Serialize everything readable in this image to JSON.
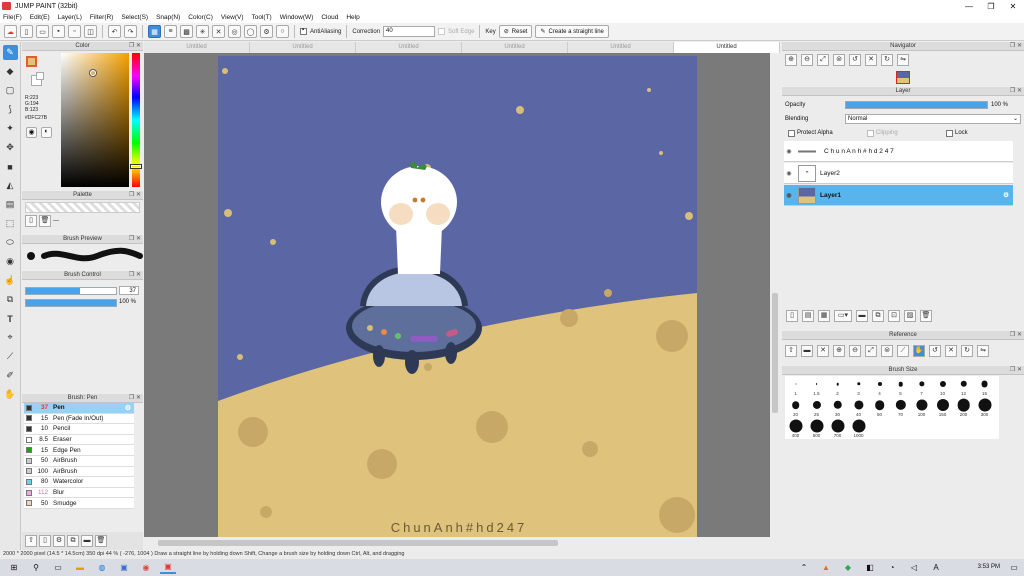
{
  "window": {
    "title": "JUMP PAINT (32bit)",
    "min": "—",
    "max": "❐",
    "close": "✕"
  },
  "menu": [
    "File(F)",
    "Edit(E)",
    "Layer(L)",
    "Filter(R)",
    "Select(S)",
    "Snap(N)",
    "Color(C)",
    "View(V)",
    "Tool(T)",
    "Window(W)",
    "Cloud",
    "Help"
  ],
  "toolbar": {
    "antialiasing_label": "AntiAliasing",
    "correction_label": "Correction",
    "correction_value": "40",
    "soft_edge_label": "Soft Edge",
    "key_label": "Key",
    "reset_label": "Reset",
    "straight_line_label": "Create a straight line"
  },
  "tabs": [
    "Untitled",
    "Untitled",
    "Untitled",
    "Untitled",
    "Untitled",
    "Untitled"
  ],
  "color_panel": {
    "title": "Color",
    "r": "R:223",
    "g": "G:194",
    "b": "B:123",
    "hex": "#DFC27B",
    "fg_color": "#dfc27b"
  },
  "palette": {
    "title": "Palette",
    "ellipsis": "---"
  },
  "brush_preview": {
    "title": "Brush Preview"
  },
  "brush_control": {
    "title": "Brush Control",
    "size": "37",
    "size_level": 0.6,
    "opacity": "100 %",
    "opacity_level": 1.0
  },
  "brush_list": {
    "title": "Brush: Pen",
    "items": [
      {
        "size": "37",
        "name": "Pen",
        "color": "#333333"
      },
      {
        "size": "15",
        "name": "Pen (Fade In/Out)",
        "color": "#333333"
      },
      {
        "size": "10",
        "name": "Pencil",
        "color": "#333333"
      },
      {
        "size": "8.5",
        "name": "Eraser",
        "color": "#ffffff"
      },
      {
        "size": "15",
        "name": "Edge Pen",
        "color": "#19a319"
      },
      {
        "size": "50",
        "name": "AirBrush",
        "color": "#cccccc"
      },
      {
        "size": "100",
        "name": "AirBrush",
        "color": "#cccccc"
      },
      {
        "size": "80",
        "name": "Watercolor",
        "color": "#77ccf0"
      },
      {
        "size": "112",
        "name": "Blur",
        "color": "#f0a8e0"
      },
      {
        "size": "50",
        "name": "Smudge",
        "color": "#f5d2b8"
      }
    ]
  },
  "canvas": {
    "signature": "ChunAnh#hd247",
    "sky_color": "#5a67a4",
    "ground_color": "#dfc27b"
  },
  "status_bar": "2000 * 2000 pixel   (14.5 * 14.5cm)   350 dpi   44 %   ( -276, 1004 )   Draw a straight line by holding down Shift, Change a brush size by holding down Ctrl, Alt, and dragging",
  "navigator": {
    "title": "Navigator"
  },
  "layer_panel": {
    "title": "Layer",
    "opacity_label": "Opacity",
    "opacity_value": "100 %",
    "opacity_level": 1.0,
    "blending_label": "Blending",
    "blending_value": "Normal",
    "protect_alpha": "Protect Alpha",
    "clipping": "Clipping",
    "lock": "Lock",
    "layers": [
      {
        "name": "C h u n A n h # h d 2 4 7"
      },
      {
        "name": "Layer2"
      },
      {
        "name": "Layer1"
      }
    ]
  },
  "reference": {
    "title": "Reference"
  },
  "brush_size": {
    "title": "Brush Size",
    "sizes": [
      "1",
      "1.5",
      "2",
      "3",
      "4",
      "5",
      "7",
      "10",
      "12",
      "15",
      "20",
      "25",
      "30",
      "40",
      "50",
      "70",
      "100",
      "150",
      "200",
      "300",
      "400",
      "500",
      "700",
      "1000"
    ]
  },
  "taskbar": {
    "time": "3:53 PM",
    "date": ""
  }
}
